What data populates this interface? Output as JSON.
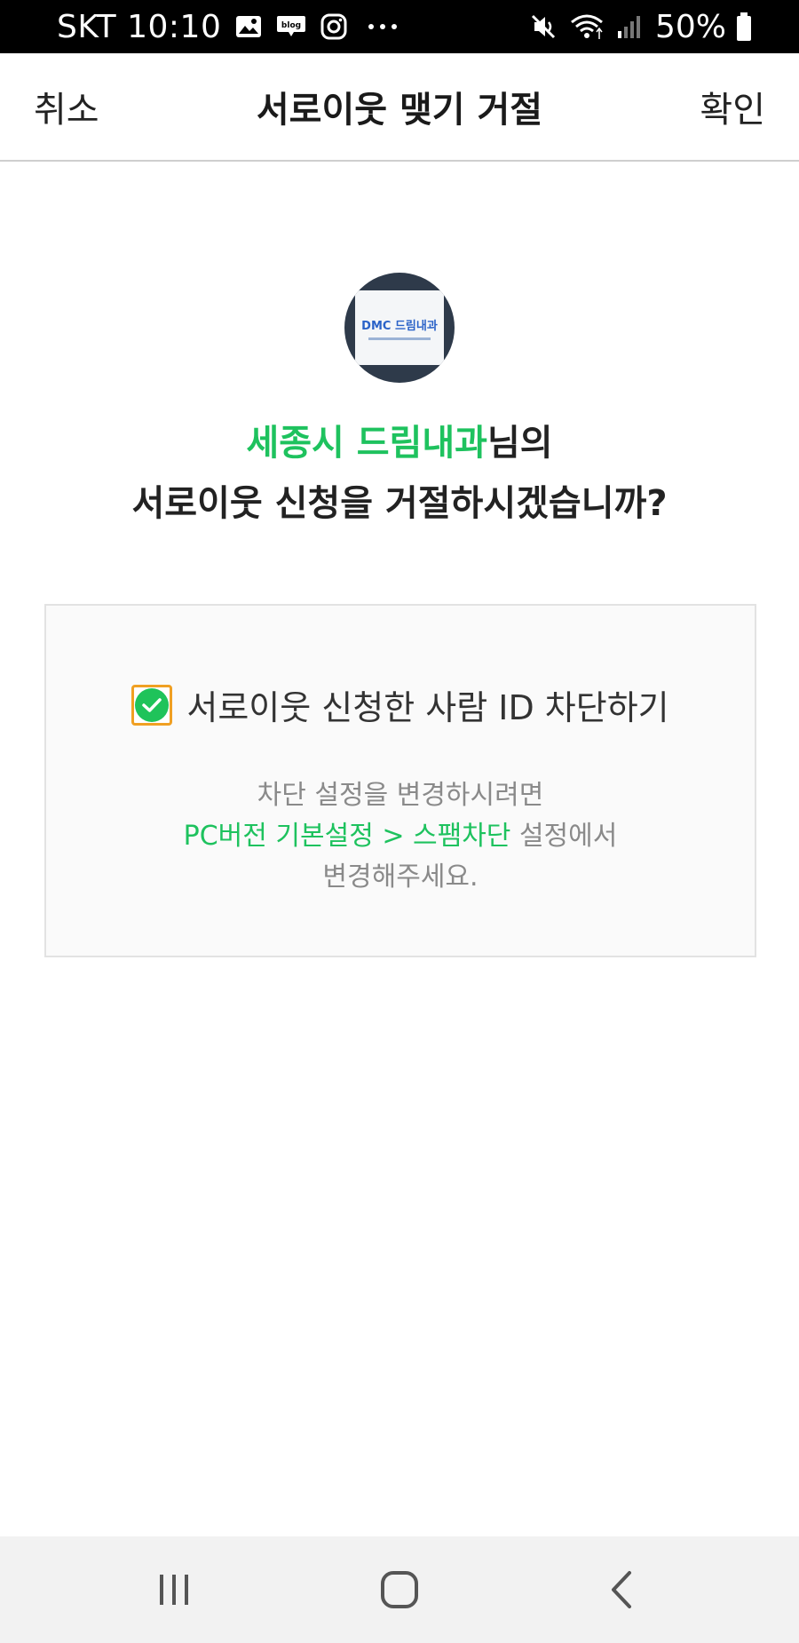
{
  "status_bar": {
    "carrier_time": "SKT 10:10",
    "icons": [
      "image-icon",
      "blog-icon",
      "instagram-icon",
      "more-dots-icon"
    ],
    "right_icons": [
      "mute-icon",
      "wifi-icon",
      "signal-icon"
    ],
    "battery": "50%"
  },
  "header": {
    "cancel": "취소",
    "title": "서로이웃 맺기 거절",
    "confirm": "확인"
  },
  "avatar": {
    "logo_text": "DMC 드림내과"
  },
  "message": {
    "name": "세종시 드림내과",
    "name_suffix": "님의",
    "line2": "서로이웃 신청을 거절하시겠습니까?"
  },
  "block_option": {
    "checked": true,
    "label": "서로이웃 신청한 사람 ID 차단하기",
    "note_line1": "차단 설정을 변경하시려면",
    "note_link": "PC버전 기본설정 > 스팸차단",
    "note_line2_suffix": " 설정에서",
    "note_line3": "변경해주세요."
  },
  "colors": {
    "accent_green": "#1ec25e",
    "checkbox_border": "#f0a023"
  },
  "nav_bar": [
    "recent-apps-icon",
    "home-icon",
    "back-icon"
  ]
}
